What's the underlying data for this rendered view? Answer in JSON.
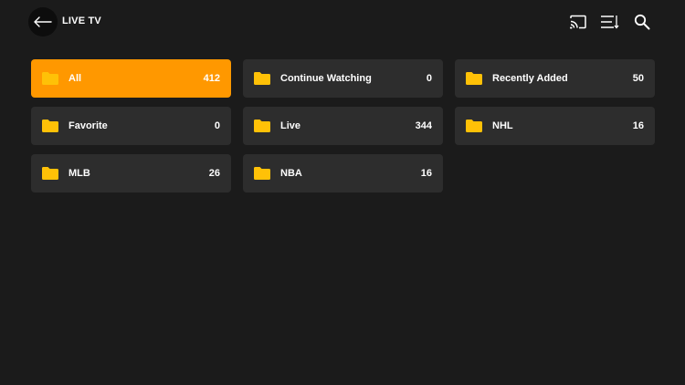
{
  "header": {
    "title": "LIVE TV",
    "back_icon": "arrow-left-icon",
    "icons": [
      "cast-icon",
      "sort-list-icon",
      "search-icon"
    ]
  },
  "colors": {
    "background": "#1b1b1b",
    "tile": "#2d2d2d",
    "active_tile": "#ff9800",
    "folder": "#ffc107"
  },
  "categories": [
    {
      "label": "All",
      "count": "412",
      "active": true
    },
    {
      "label": "Continue Watching",
      "count": "0",
      "active": false
    },
    {
      "label": "Recently Added",
      "count": "50",
      "active": false
    },
    {
      "label": "Favorite",
      "count": "0",
      "active": false
    },
    {
      "label": "Live",
      "count": "344",
      "active": false
    },
    {
      "label": "NHL",
      "count": "16",
      "active": false
    },
    {
      "label": "MLB",
      "count": "26",
      "active": false
    },
    {
      "label": "NBA",
      "count": "16",
      "active": false
    }
  ]
}
